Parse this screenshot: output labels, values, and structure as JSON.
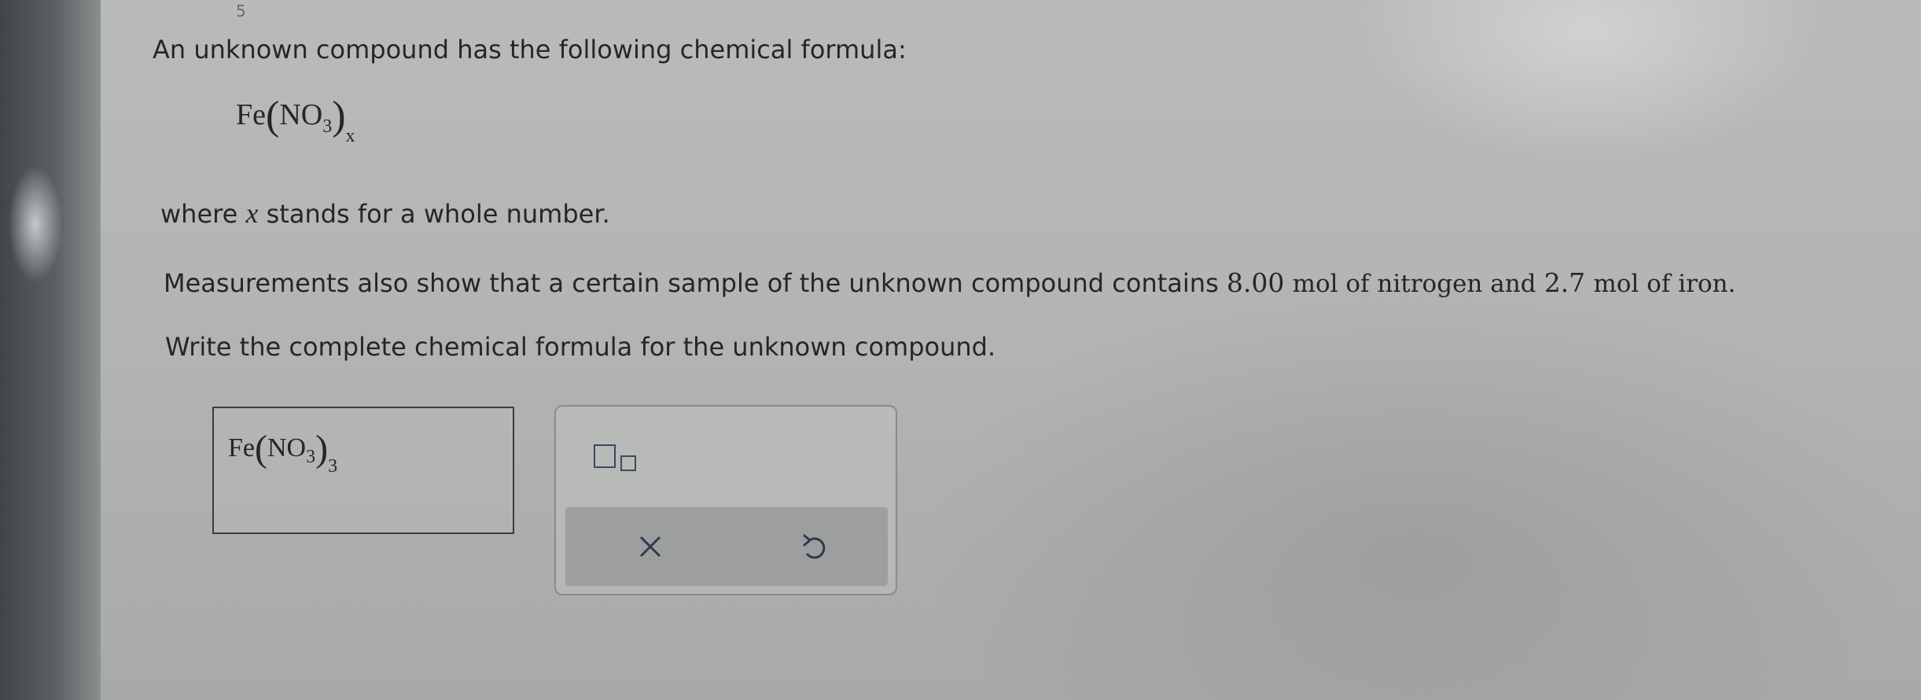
{
  "question": {
    "intro": "An unknown compound has the following chemical formula:",
    "formula": {
      "element": "Fe",
      "group": "NO",
      "group_subscript": "3",
      "outer_subscript": "x"
    },
    "where_prefix": "where",
    "variable": "x",
    "where_suffix": "stands for a whole number.",
    "measure_prefix": "Measurements also show that a certain sample of the unknown compound contains",
    "nitrogen_amount": "8.00",
    "nitrogen_text": "mol of nitrogen and",
    "iron_amount": "2.7",
    "iron_text": "mol of iron.",
    "instruction": "Write the complete chemical formula for the unknown compound."
  },
  "answer": {
    "element": "Fe",
    "group": "NO",
    "group_subscript": "3",
    "outer_subscript": "3"
  },
  "tools": {
    "clear_symbol": "×",
    "undo_symbol": "↺"
  },
  "colors": {
    "text": "#262626",
    "icon": "#3a4a66",
    "toolbar": "#9d9f9e"
  }
}
